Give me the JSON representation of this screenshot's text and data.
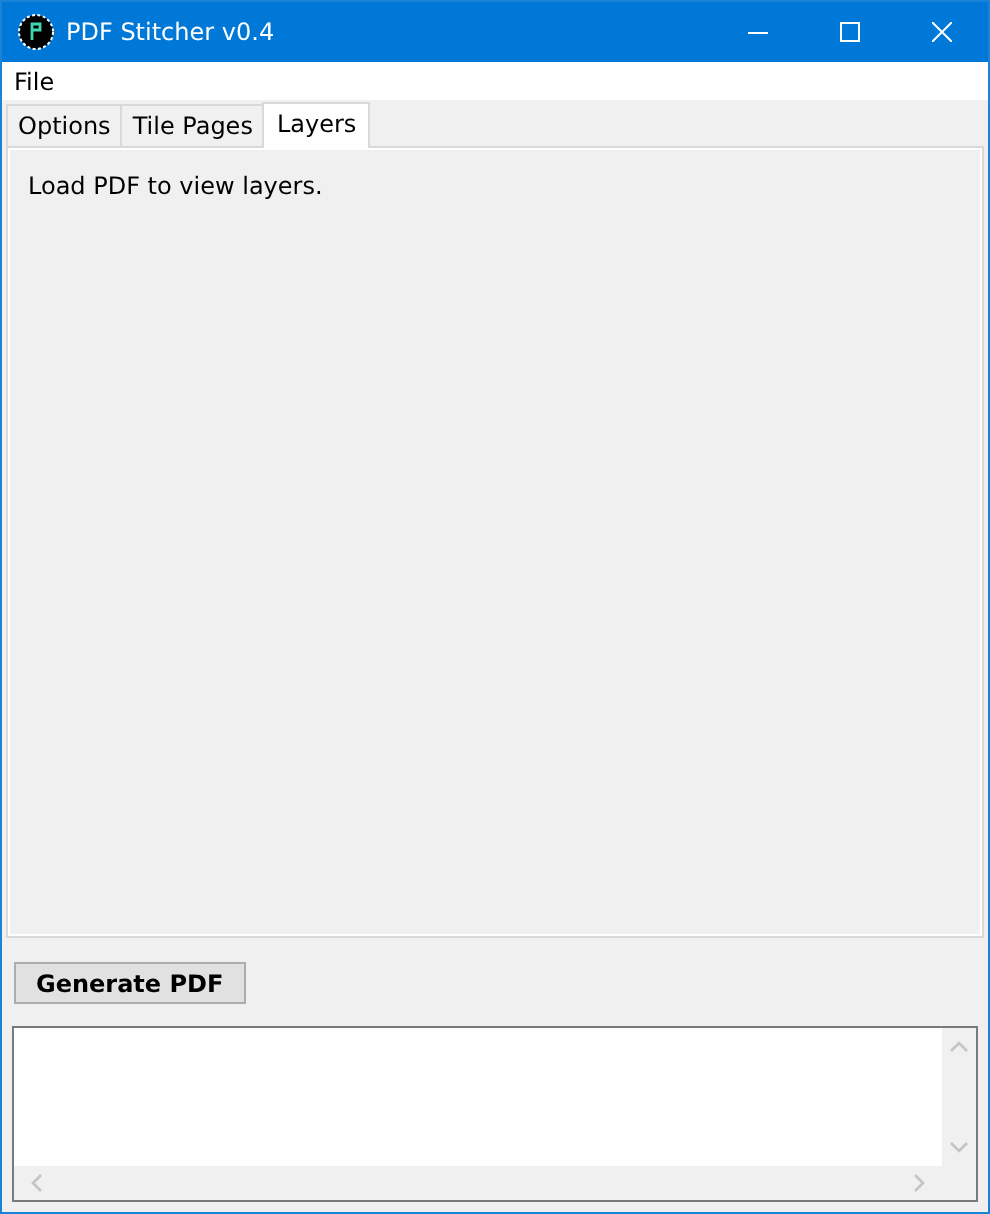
{
  "window": {
    "title": "PDF Stitcher v0.4"
  },
  "menu": [
    "File"
  ],
  "tabs": [
    {
      "label": "Options",
      "selected": false
    },
    {
      "label": "Tile Pages",
      "selected": false
    },
    {
      "label": "Layers",
      "selected": true
    }
  ],
  "panel": {
    "message": "Load PDF to view layers."
  },
  "buttons": [
    "Generate PDF"
  ]
}
